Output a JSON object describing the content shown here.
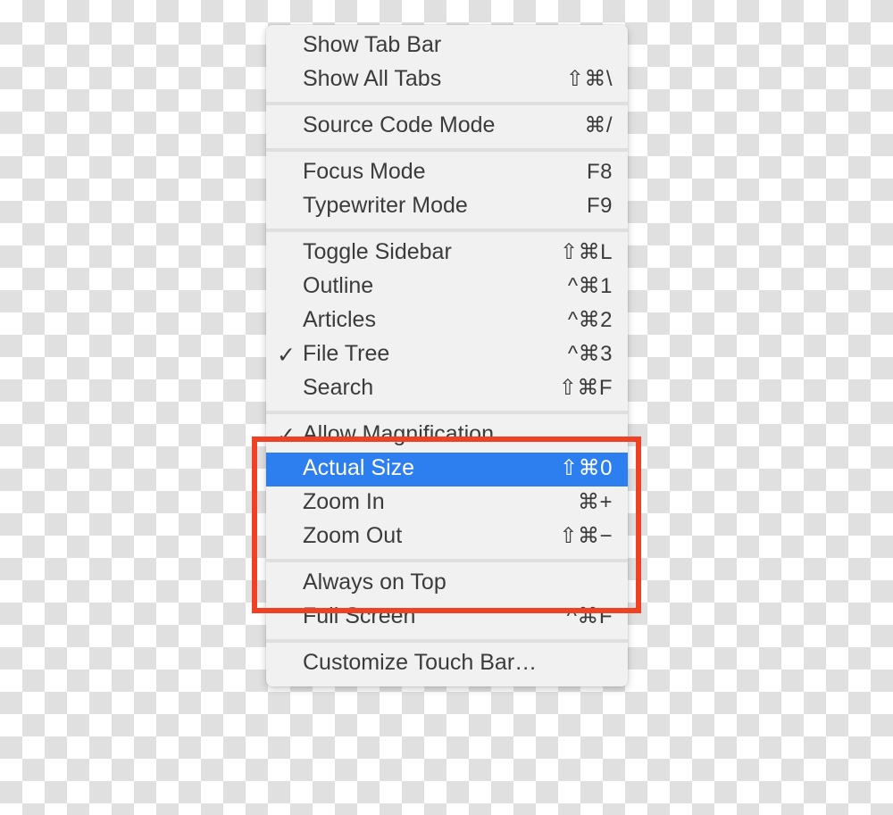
{
  "menu": {
    "name": "view-menu",
    "selected_item": "Actual Size",
    "colors": {
      "panel_background": "#f1f1f1",
      "text": "#3b3b3b",
      "selection_blue": "#2d7ff0",
      "selection_text": "#ffffff",
      "separator": "#dfdfdf",
      "annotation_red": "#ef4123",
      "checkerboard_light": "#ffffff",
      "checkerboard_dark": "#e0e0e0"
    },
    "check_glyph": "✓",
    "groups": [
      {
        "id": "tabs-group",
        "items": [
          {
            "label": "Show Tab Bar",
            "shortcut": "",
            "checked": false
          },
          {
            "label": "Show All Tabs",
            "shortcut": "⇧⌘\\",
            "checked": false
          }
        ]
      },
      {
        "id": "source-group",
        "items": [
          {
            "label": "Source Code Mode",
            "shortcut": "⌘/",
            "checked": false
          }
        ]
      },
      {
        "id": "modes-group",
        "items": [
          {
            "label": "Focus Mode",
            "shortcut": "F8",
            "checked": false
          },
          {
            "label": "Typewriter Mode",
            "shortcut": "F9",
            "checked": false
          }
        ]
      },
      {
        "id": "sidebar-group",
        "items": [
          {
            "label": "Toggle Sidebar",
            "shortcut": "⇧⌘L",
            "checked": false
          },
          {
            "label": "Outline",
            "shortcut": "^⌘1",
            "checked": false
          },
          {
            "label": "Articles",
            "shortcut": "^⌘2",
            "checked": false
          },
          {
            "label": "File Tree",
            "shortcut": "^⌘3",
            "checked": true
          },
          {
            "label": "Search",
            "shortcut": "⇧⌘F",
            "checked": false
          }
        ]
      },
      {
        "id": "zoom-group",
        "items": [
          {
            "label": "Allow Magnification",
            "shortcut": "",
            "checked": true
          },
          {
            "label": "Actual Size",
            "shortcut": "⇧⌘0",
            "checked": false,
            "selected": true
          },
          {
            "label": "Zoom In",
            "shortcut": "⌘+",
            "checked": false
          },
          {
            "label": "Zoom Out",
            "shortcut": "⇧⌘−",
            "checked": false
          }
        ]
      },
      {
        "id": "window-group",
        "items": [
          {
            "label": "Always on Top",
            "shortcut": "",
            "checked": false
          },
          {
            "label": "Full Screen",
            "shortcut": "^⌘F",
            "checked": false
          }
        ]
      },
      {
        "id": "touchbar-group",
        "items": [
          {
            "label": "Customize Touch Bar…",
            "shortcut": "",
            "checked": false
          }
        ]
      }
    ]
  },
  "annotation": {
    "name": "zoom-section-highlight",
    "shape": "rectangle",
    "color": "#ef4123"
  }
}
